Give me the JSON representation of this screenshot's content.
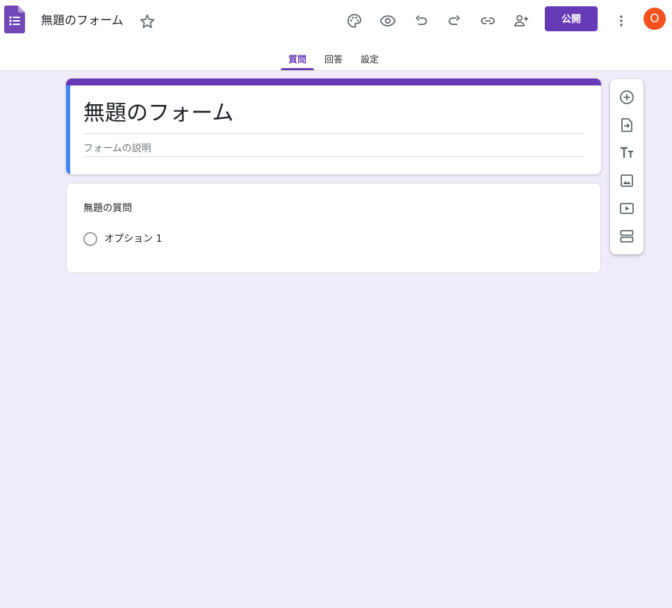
{
  "header": {
    "doc_title": "無題のフォーム",
    "publish_label": "公開",
    "avatar_initial": "O",
    "icons": [
      "palette-icon",
      "preview-eye-icon",
      "undo-icon",
      "redo-icon",
      "link-icon",
      "add-collaborator-icon",
      "more-vert-icon",
      "star-icon"
    ]
  },
  "tabs": [
    {
      "label": "質問",
      "active": true
    },
    {
      "label": "回答",
      "active": false
    },
    {
      "label": "設定",
      "active": false
    }
  ],
  "form": {
    "title": "無題のフォーム",
    "description_placeholder": "フォームの説明"
  },
  "question": {
    "title": "無題の質問",
    "options": [
      "オプション 1"
    ]
  },
  "side_toolbar": {
    "icons": [
      "add-question-icon",
      "import-questions-icon",
      "add-title-icon",
      "add-image-icon",
      "add-video-icon",
      "add-section-icon"
    ]
  },
  "colors": {
    "brand": "#673ab7",
    "background": "#f0ebf8",
    "accent_left_band": "#4285f4",
    "avatar": "#f4511e"
  }
}
